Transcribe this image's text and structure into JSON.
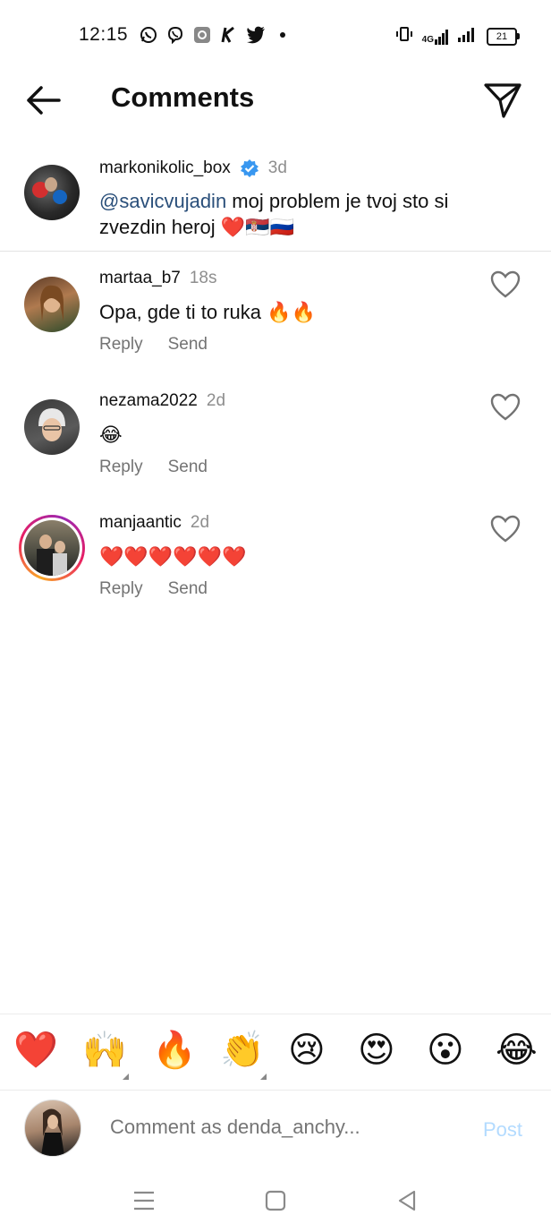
{
  "status_bar": {
    "time": "12:15",
    "left_icons": [
      "whatsapp-icon",
      "viber-icon",
      "settings-app-icon",
      "k-app-icon",
      "twitter-icon",
      "dot-icon"
    ],
    "network": "4G",
    "battery": "21"
  },
  "header": {
    "title": "Comments"
  },
  "caption": {
    "username": "markonikolic_box",
    "verified": true,
    "time": "3d",
    "mention": "@savicvujadin",
    "text": " moj problem je tvoj sto si zvezdin heroj ❤️🇷🇸🇷🇺"
  },
  "comments": [
    {
      "username": "martaa_b7",
      "time": "18s",
      "text": "Opa, gde ti to ruka 🔥🔥",
      "reply": "Reply",
      "send": "Send"
    },
    {
      "username": "nezama2022",
      "time": "2d",
      "text": "😂",
      "reply": "Reply",
      "send": "Send"
    },
    {
      "username": "manjaantic",
      "time": "2d",
      "text": "❤️❤️❤️❤️❤️❤️",
      "reply": "Reply",
      "send": "Send"
    }
  ],
  "emoji_bar": [
    "❤️",
    "🙌",
    "🔥",
    "👏",
    "😢",
    "😍",
    "😮",
    "😂"
  ],
  "composer": {
    "placeholder": "Comment as denda_anchy...",
    "post_label": "Post"
  },
  "colors": {
    "mention": "#2a4f7a",
    "verified": "#3897f0",
    "post_disabled": "#b3dbff",
    "meta_gray": "#8e8e8e",
    "story_ring": [
      "#f9a825",
      "#e91e63",
      "#9c27b0"
    ]
  }
}
